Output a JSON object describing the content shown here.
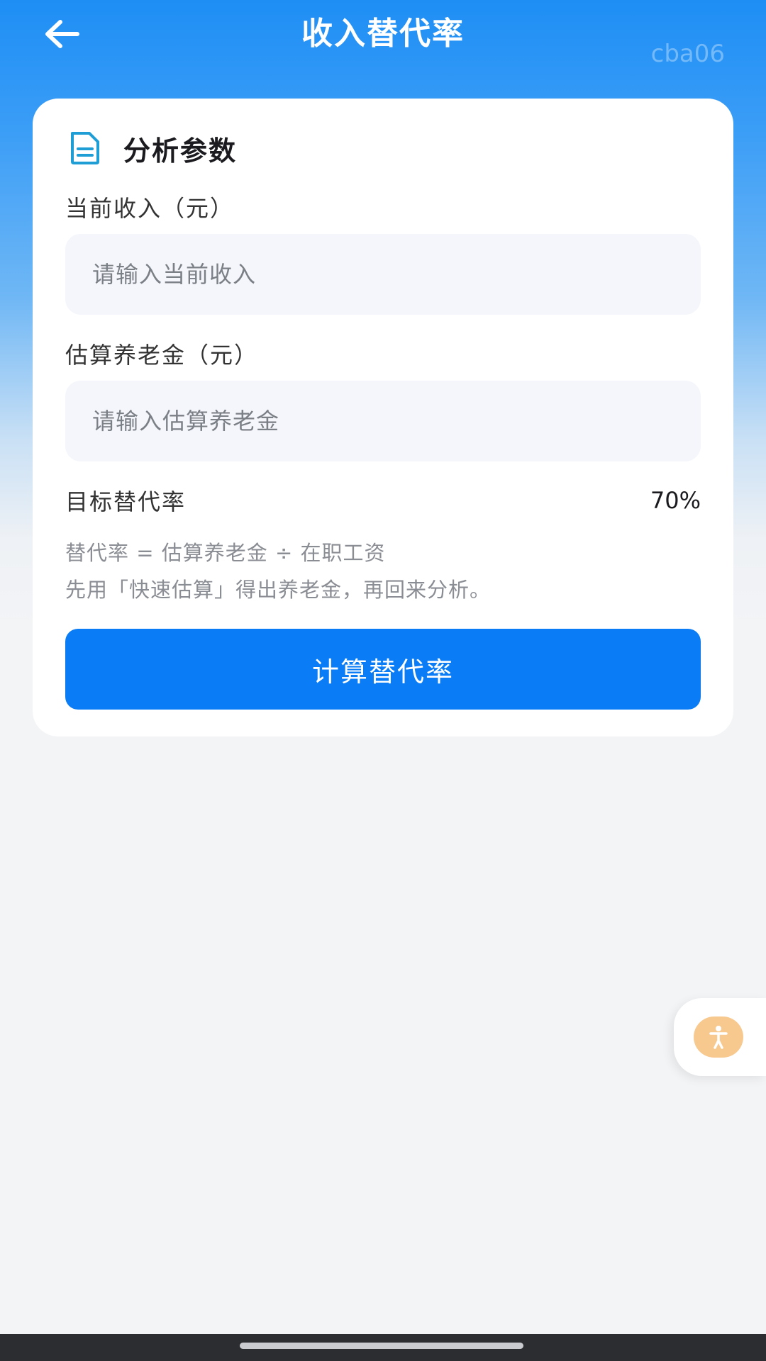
{
  "header": {
    "title": "收入替代率",
    "back_icon": "arrow-left-icon",
    "watermark": "cba06"
  },
  "card": {
    "icon": "document-icon",
    "title": "分析参数",
    "fields": [
      {
        "label": "当前收入（元）",
        "placeholder": "请输入当前收入",
        "value": ""
      },
      {
        "label": "估算养老金（元）",
        "placeholder": "请输入估算养老金",
        "value": ""
      }
    ],
    "target_rate": {
      "label": "目标替代率",
      "value": "70%"
    },
    "notes": [
      "替代率 = 估算养老金 ÷ 在职工资",
      "先用「快速估算」得出养老金，再回来分析。"
    ],
    "button_label": "计算替代率"
  },
  "floating_button": {
    "icon": "accessibility-person-icon"
  },
  "colors": {
    "primary": "#0a7cf6",
    "header_gradient_top": "#1e8ef5",
    "page_background": "#f3f4f6",
    "icon_accent": "#1f9ed6",
    "float_button": "#f7c98f"
  }
}
